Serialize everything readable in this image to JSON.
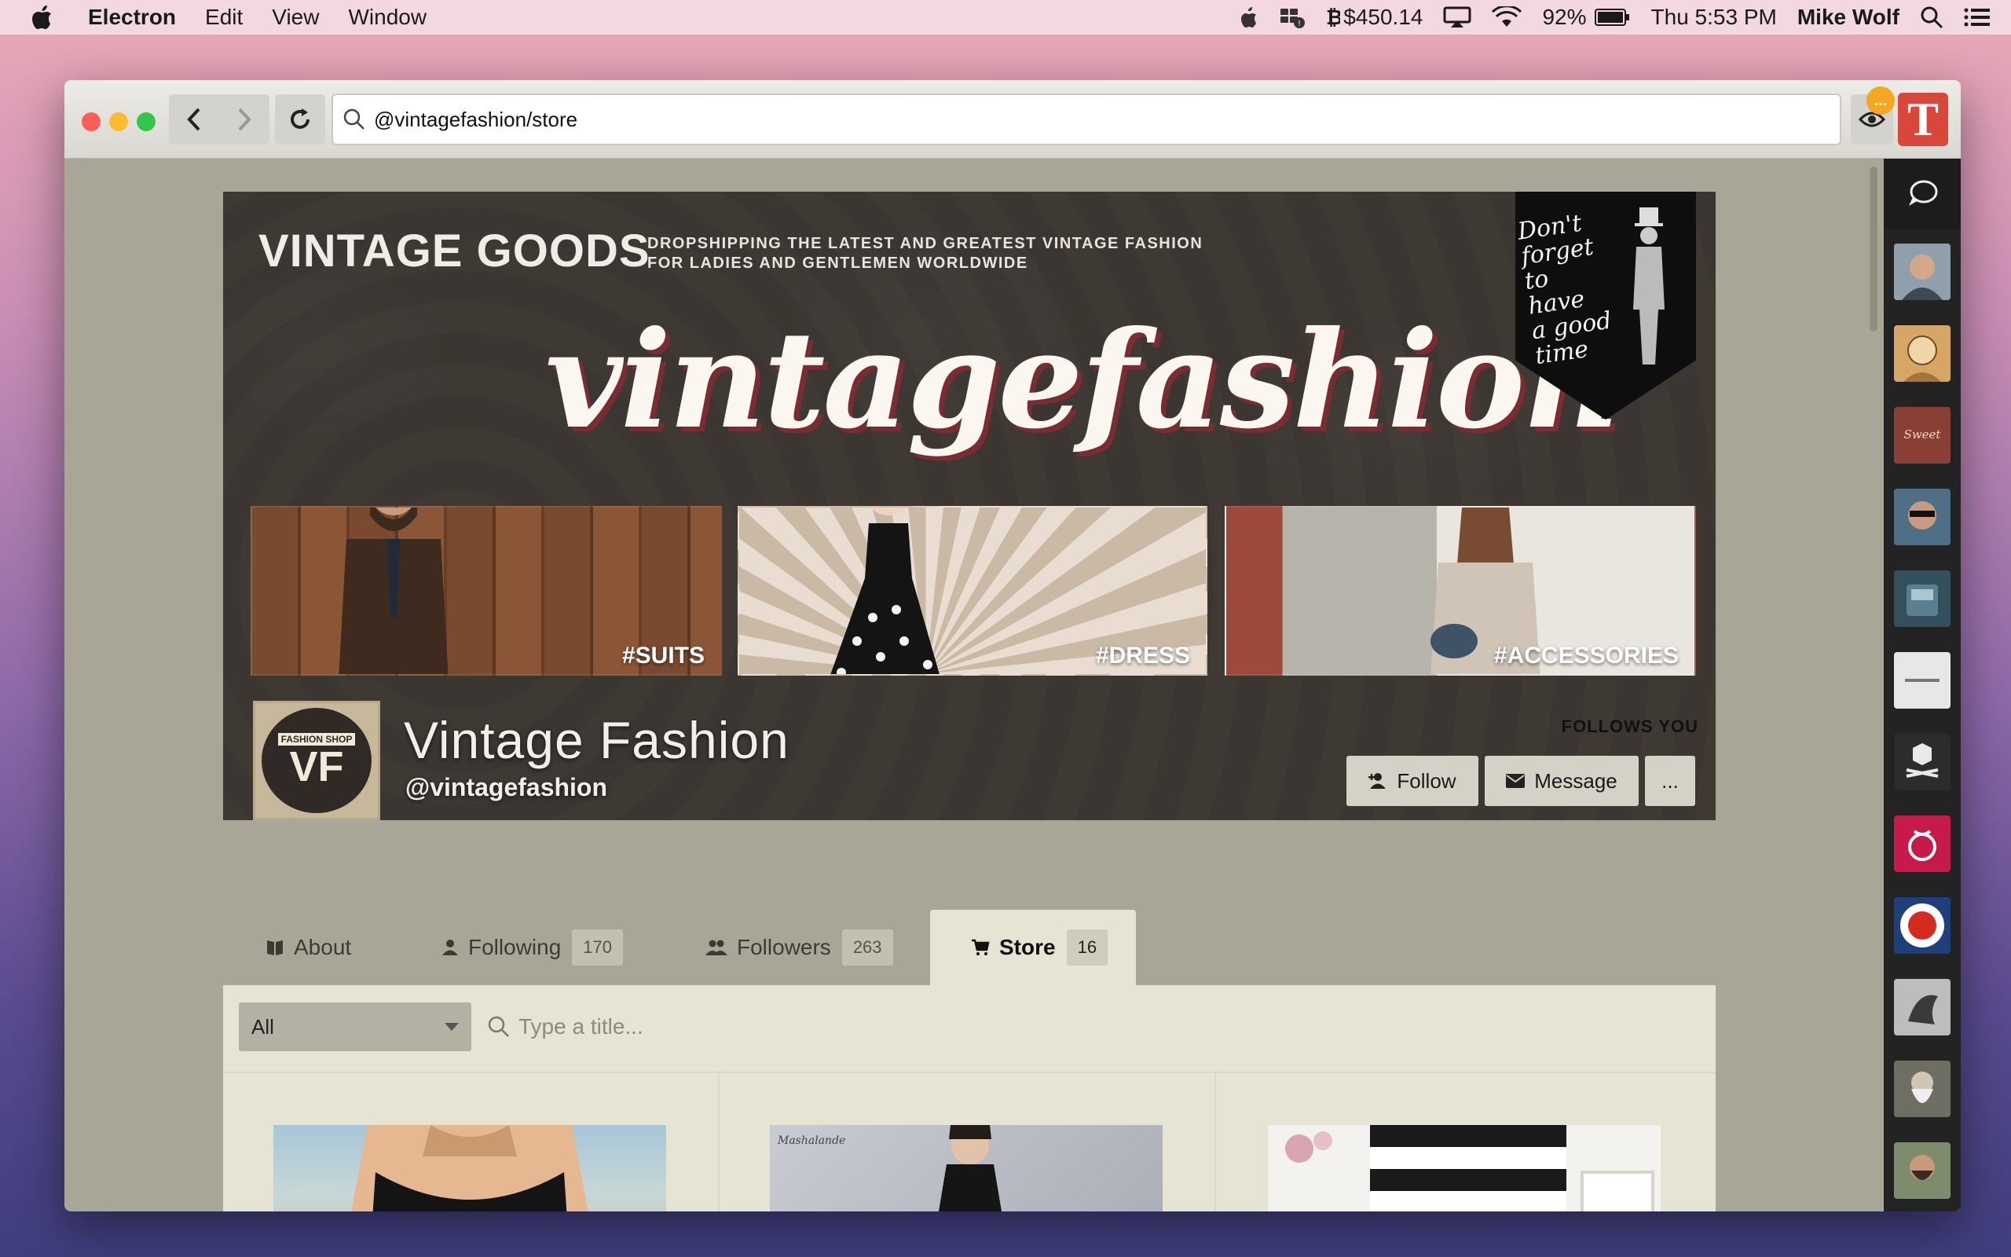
{
  "menubar": {
    "app_name": "Electron",
    "menus": [
      "Edit",
      "View",
      "Window"
    ],
    "btc_price": "$450.14",
    "battery": "92%",
    "clock": "Thu 5:53 PM",
    "user": "Mike Wolf"
  },
  "browser": {
    "url": "@vintagefashion/store",
    "notification_badge": "..."
  },
  "banner": {
    "brand": "VINTAGE GOODS",
    "tagline_line1": "DROPSHIPPING THE LATEST AND GREATEST VINTAGE FASHION",
    "tagline_line2": "FOR LADIES AND GENTLEMEN WORLDWIDE",
    "script_title": "vintagefashion",
    "pennant_text": [
      "Don't",
      "forget",
      "to",
      "have",
      "a good",
      "time"
    ],
    "photo_tags": [
      "#SUITS",
      "#DRESS",
      "#ACCESSORIES"
    ]
  },
  "profile": {
    "logo_top": "FASHION SHOP",
    "logo_initials": "VF",
    "name": "Vintage Fashion",
    "handle": "@vintagefashion",
    "follows_you": "FOLLOWS YOU",
    "follow_label": "Follow",
    "message_label": "Message",
    "more_label": "..."
  },
  "tabs": {
    "about": {
      "label": "About"
    },
    "following": {
      "label": "Following",
      "count": "170"
    },
    "followers": {
      "label": "Followers",
      "count": "263"
    },
    "store": {
      "label": "Store",
      "count": "16"
    }
  },
  "filter": {
    "selected": "All",
    "placeholder": "Type a title..."
  },
  "colors": {
    "accent_red": "#d9473b",
    "notification": "#f5a623",
    "tab_active_bg": "#e6e5d4",
    "tab_bar_bg": "#a8a797"
  },
  "sidebar_avatars": [
    "avatar-man",
    "avatar-sketch",
    "avatar-sweet-express",
    "avatar-sunglasses",
    "avatar-train",
    "avatar-store-logo",
    "avatar-crossbones",
    "avatar-raspberry-pi",
    "avatar-roundel",
    "avatar-bird",
    "avatar-darwin",
    "avatar-bearded"
  ]
}
